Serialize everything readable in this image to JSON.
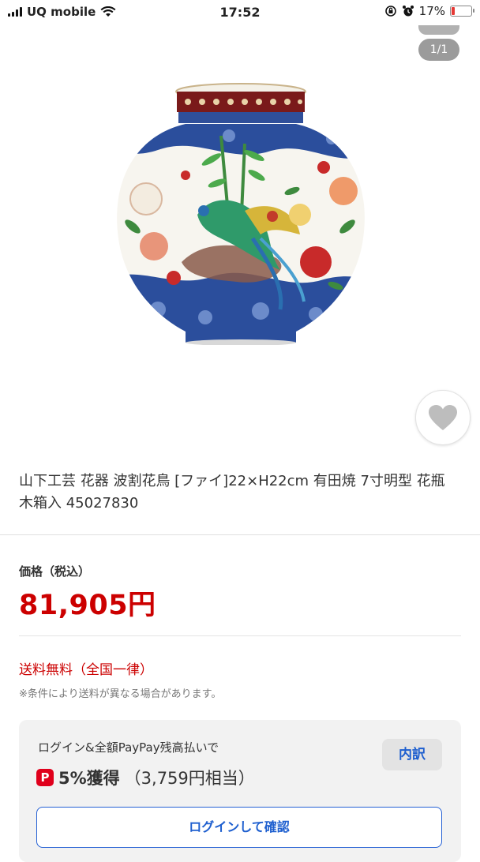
{
  "status_bar": {
    "carrier": "UQ mobile",
    "time": "17:52",
    "battery_percent": "17%",
    "battery_level": 0.17,
    "icons": [
      "signal-icon",
      "wifi-icon",
      "screen-lock-icon",
      "alarm-icon",
      "battery-icon"
    ]
  },
  "gallery": {
    "counter": "1/1"
  },
  "product": {
    "title": "山下工芸 花器 波割花鳥 [ファイ]22×H22cm 有田焼 7寸明型 花瓶 木箱入 45027830"
  },
  "price": {
    "label": "価格（税込）",
    "value": "81,905円"
  },
  "shipping": {
    "label": "送料無料（全国一律）",
    "note": "※条件により送料が異なる場合があります。"
  },
  "points": {
    "login_text": "ログイン&全額PayPay残高払いで",
    "paypay_icon_glyph": "P",
    "rate": "5%獲得",
    "equivalent": "（3,759円相当）",
    "breakdown_label": "内訳",
    "login_button_label": "ログインして確認"
  },
  "colors": {
    "price_red": "#cc0000",
    "link_blue": "#1e5fcf",
    "paypay_red": "#e0001c"
  }
}
